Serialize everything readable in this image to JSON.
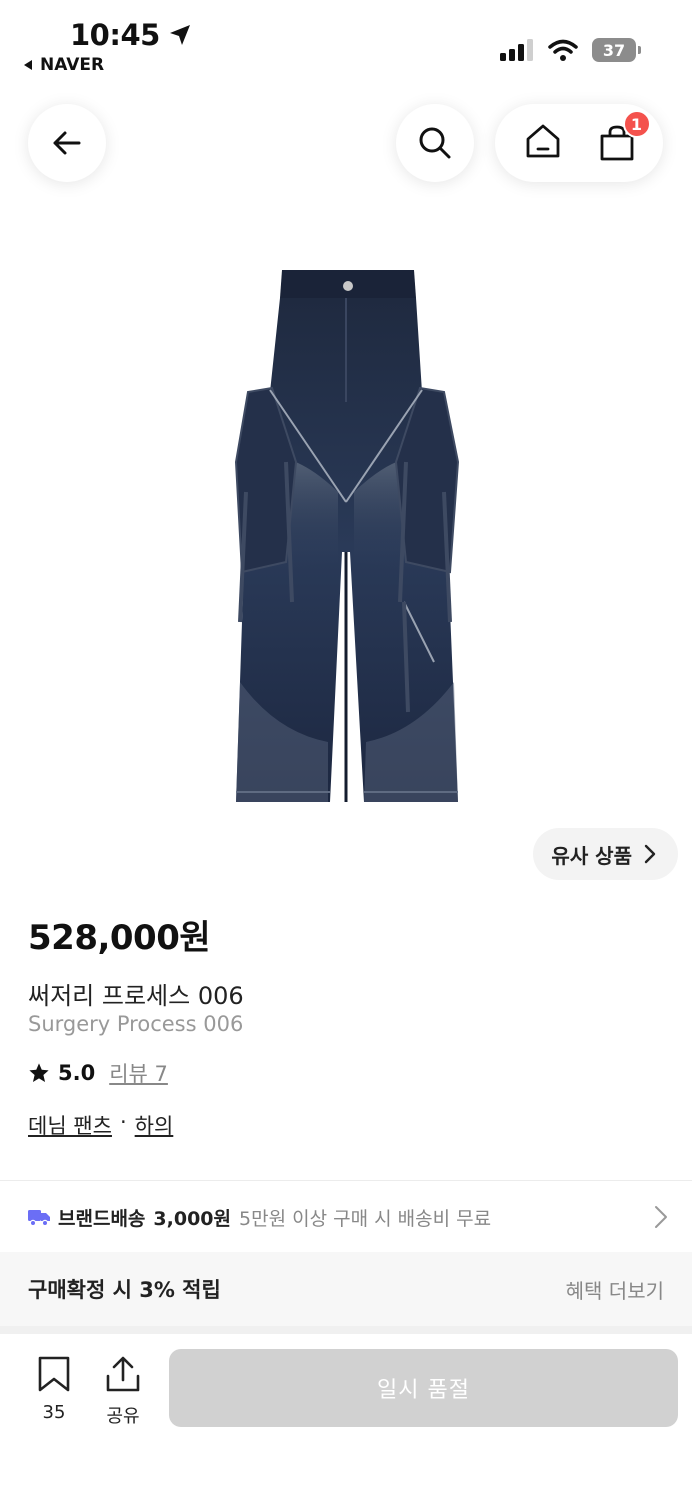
{
  "status_bar": {
    "time": "10:45",
    "back_app": "NAVER",
    "battery": "37"
  },
  "header": {
    "cart_count": "1"
  },
  "similar_button": "유사 상품",
  "product": {
    "price": "528,000원",
    "name_ko": "써저리 프로세스 006",
    "name_en": "Surgery Process 006",
    "rating": "5.0",
    "review_label": "리뷰 7",
    "category_1": "데님 팬츠",
    "category_sep": "·",
    "category_2": "하의"
  },
  "shipping": {
    "label": "브랜드배송",
    "fee": "3,000원",
    "condition": "5만원 이상 구매 시 배송비 무료"
  },
  "benefit": {
    "title": "구매확정 시 3% 적립",
    "more": "혜택 더보기"
  },
  "bottom": {
    "bookmark_count": "35",
    "share_label": "공유",
    "buy_button": "일시 품절"
  },
  "colors": {
    "accent_icon": "#6b6ef5",
    "badge": "#f4524d",
    "disabled_button": "#d1d1d1"
  }
}
